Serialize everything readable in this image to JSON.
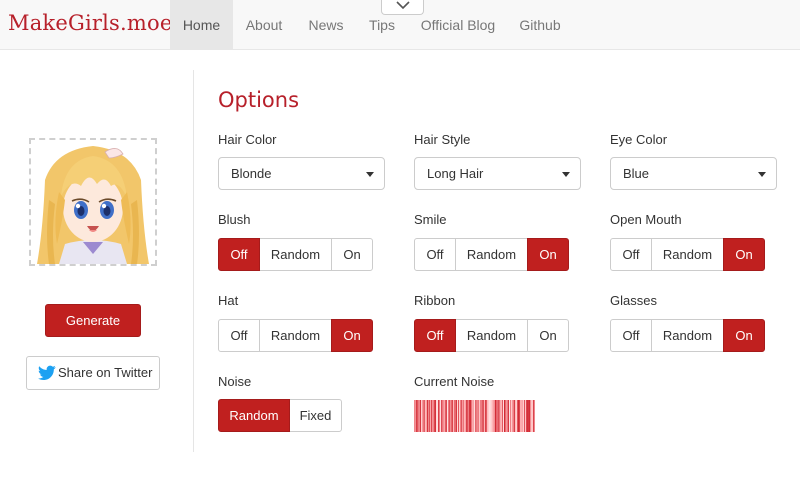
{
  "nav": {
    "brand": "MakeGirls.moe",
    "items": [
      {
        "label": "Home",
        "active": true
      },
      {
        "label": "About",
        "active": false
      },
      {
        "label": "News",
        "active": false
      },
      {
        "label": "Tips",
        "active": false
      },
      {
        "label": "Official Blog",
        "active": false
      },
      {
        "label": "Github",
        "active": false
      }
    ]
  },
  "sidebar": {
    "generate_label": "Generate",
    "twitter_label": "Share on Twitter"
  },
  "options": {
    "title": "Options",
    "hair_color": {
      "label": "Hair Color",
      "value": "Blonde"
    },
    "hair_style": {
      "label": "Hair Style",
      "value": "Long Hair"
    },
    "eye_color": {
      "label": "Eye Color",
      "value": "Blue"
    },
    "blush": {
      "label": "Blush",
      "choices": [
        "Off",
        "Random",
        "On"
      ],
      "selected": "Off"
    },
    "smile": {
      "label": "Smile",
      "choices": [
        "Off",
        "Random",
        "On"
      ],
      "selected": "On"
    },
    "open_mouth": {
      "label": "Open Mouth",
      "choices": [
        "Off",
        "Random",
        "On"
      ],
      "selected": "On"
    },
    "hat": {
      "label": "Hat",
      "choices": [
        "Off",
        "Random",
        "On"
      ],
      "selected": "On"
    },
    "ribbon": {
      "label": "Ribbon",
      "choices": [
        "Off",
        "Random",
        "On"
      ],
      "selected": "Off"
    },
    "glasses": {
      "label": "Glasses",
      "choices": [
        "Off",
        "Random",
        "On"
      ],
      "selected": "On"
    },
    "noise": {
      "label": "Noise",
      "choices": [
        "Random",
        "Fixed"
      ],
      "selected": "Random"
    },
    "current_noise": {
      "label": "Current Noise"
    }
  },
  "colors": {
    "accent": "#c0201f",
    "brand": "#b7202a",
    "twitter": "#1da1f2"
  },
  "icons": {
    "nav_toggle": "chevron-down-icon",
    "twitter": "twitter-bird-icon"
  }
}
